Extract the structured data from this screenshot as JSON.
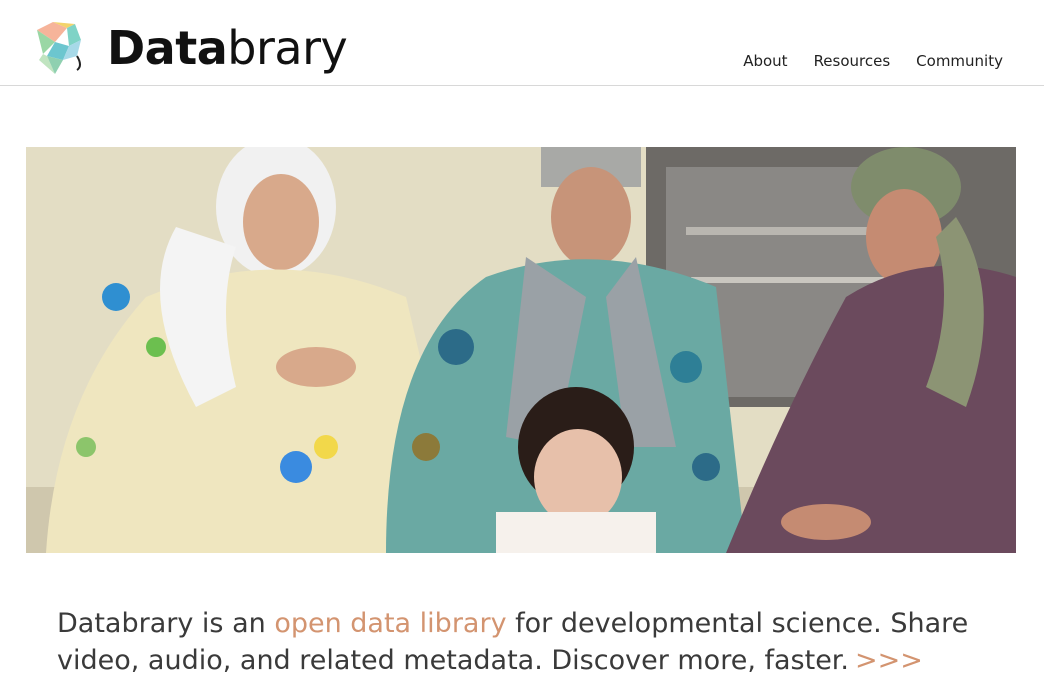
{
  "brand": {
    "name_bold": "Data",
    "name_light": "brary",
    "logo_icon": "leaf-logo-icon",
    "accent": "#d39470"
  },
  "nav": {
    "items": [
      {
        "label": "About"
      },
      {
        "label": "Resources"
      },
      {
        "label": "Community"
      }
    ]
  },
  "hero": {
    "image_icon": "hero-photo"
  },
  "tagline": {
    "text_before": "Databrary is an ",
    "link_text": "open data library",
    "text_after": " for developmental science. Share video, audio, and related metadata. Discover more, faster.",
    "more_link": ">>>"
  }
}
